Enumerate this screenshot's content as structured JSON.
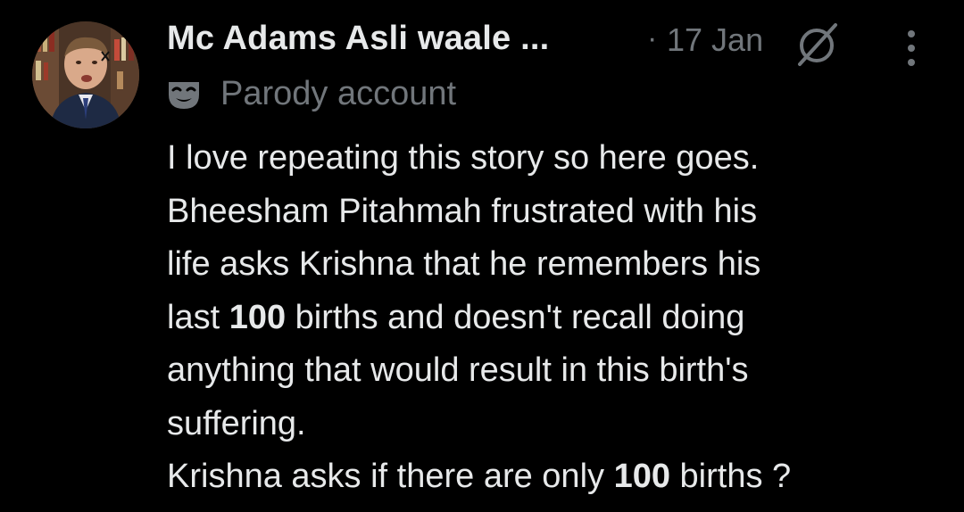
{
  "tweet": {
    "author": {
      "display_name": "Mc Adams Asli waale ...",
      "avatar_icon": "profile-photo",
      "label": "Parody account",
      "label_icon": "theater-mask-icon"
    },
    "separator": "·",
    "timestamp": "17 Jan",
    "grok_icon": "grok-icon",
    "more_icon": "more-vertical-icon",
    "body_lines": [
      {
        "parts": [
          {
            "text": "I love repeating this story so here goes.",
            "bold": false
          }
        ]
      },
      {
        "parts": [
          {
            "text": "Bheesham Pitahmah frustrated with his",
            "bold": false
          }
        ]
      },
      {
        "parts": [
          {
            "text": "life asks Krishna that he remembers his",
            "bold": false
          }
        ]
      },
      {
        "parts": [
          {
            "text": "last ",
            "bold": false
          },
          {
            "text": "100",
            "bold": true
          },
          {
            "text": " births and doesn't recall doing",
            "bold": false
          }
        ]
      },
      {
        "parts": [
          {
            "text": "anything that would result in this birth's",
            "bold": false
          }
        ]
      },
      {
        "parts": [
          {
            "text": "suffering.",
            "bold": false
          }
        ]
      },
      {
        "parts": [
          {
            "text": "Krishna asks if there are only ",
            "bold": false
          },
          {
            "text": "100",
            "bold": true
          },
          {
            "text": " births ?",
            "bold": false
          }
        ]
      }
    ],
    "colors": {
      "background": "#000000",
      "primary_text": "#e7e9ea",
      "secondary_text": "#71767b"
    }
  }
}
